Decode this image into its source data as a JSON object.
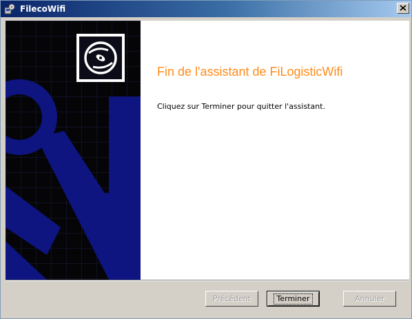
{
  "window": {
    "title": "FilecoWifi",
    "icon": "installer-app-icon",
    "close_icon": "close-icon"
  },
  "sidebar": {
    "logo_icon": "cd-disc-icon"
  },
  "main": {
    "heading": "Fin de l'assistant de FiLogisticWifi",
    "message": "Cliquez sur Terminer pour quitter l'assistant."
  },
  "buttons": {
    "previous": "Précédent",
    "finish": "Terminer",
    "cancel": "Annuler"
  },
  "colors": {
    "heading": "#ff8c1a",
    "sidebar_blue": "#0e1480",
    "titlebar_start": "#0a246a",
    "titlebar_end": "#a6caf0"
  }
}
